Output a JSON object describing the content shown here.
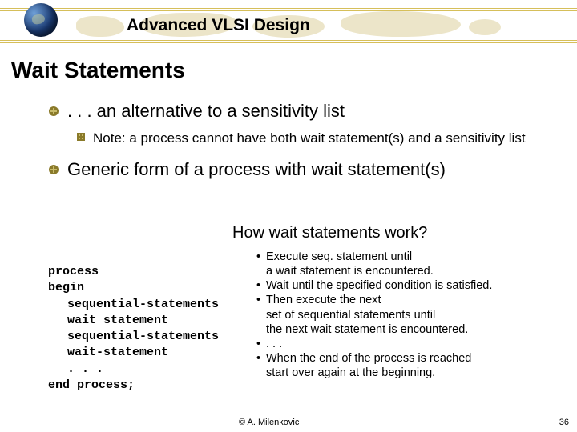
{
  "header": {
    "course_title": "Advanced VLSI Design"
  },
  "slide_title": "Wait Statements",
  "bullets": {
    "b1": ". . . an alternative to a sensitivity list",
    "b1_sub": "Note: a process cannot have both wait statement(s) and a sensitivity list",
    "b2": "Generic form of a process with wait statement(s)"
  },
  "how_title": "How wait statements work?",
  "code": {
    "l1": "process",
    "l2": "begin",
    "l3": "sequential-statements",
    "l4": "wait statement",
    "l5": "sequential-statements",
    "l6": "wait-statement",
    "l7": ". . .",
    "l8": "end process;"
  },
  "how": {
    "i1a": "Execute seq. statement until",
    "i1b": "a wait statement is encountered.",
    "i2": "Wait until the specified condition is satisfied.",
    "i3a": "Then execute the next",
    "i3b": "set of sequential statements until",
    "i3c": "the next wait statement is encountered.",
    "i4": ". . .",
    "i5a": "When the end of the process is reached",
    "i5b": "start over again at the beginning."
  },
  "footer": {
    "copyright": "©  A. Milenkovic",
    "slide_number": "36"
  }
}
